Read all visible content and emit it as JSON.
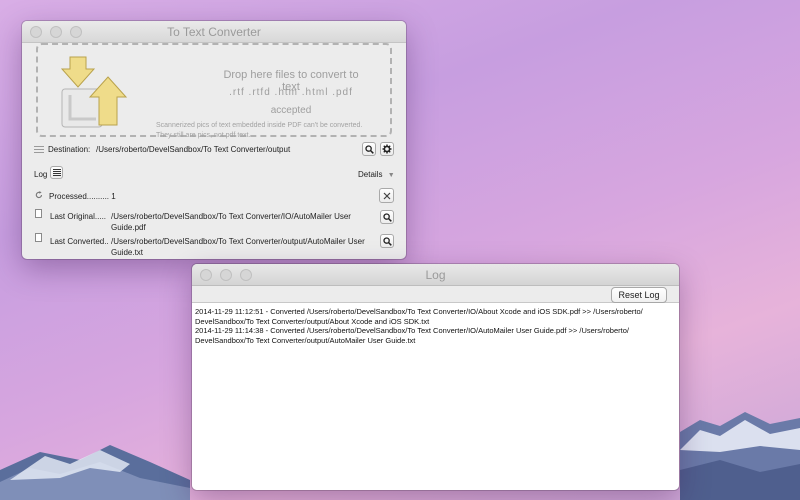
{
  "converter": {
    "title": "To Text Converter",
    "drop": {
      "title": "Drop here files to convert to text",
      "extensions": ".rtf   .rtfd   .htm   .html   .pdf",
      "accepted": "accepted",
      "note_line1": "Scannerized pics of text embedded inside PDF can't be converted.",
      "note_line2": "They still are pics, not pdf text."
    },
    "destination_label": "Destination:",
    "destination_path": "/Users/roberto/DevelSandbox/To Text Converter/output",
    "log_label": "Log",
    "details_label": "Details",
    "processed_label": "Processed.......... 1",
    "last_original_label": "Last Original.....",
    "last_original_path": "/Users/roberto/DevelSandbox/To Text Converter/IO/AutoMailer User Guide.pdf",
    "last_converted_label": "Last Converted..",
    "last_converted_path": "/Users/roberto/DevelSandbox/To Text Converter/output/AutoMailer User Guide.txt"
  },
  "log": {
    "title": "Log",
    "reset_button": "Reset Log",
    "entries": [
      "2014-11-29 11:12:51 - Converted /Users/roberto/DevelSandbox/To Text Converter/IO/About Xcode and iOS SDK.pdf  >>  /Users/roberto/",
      "DevelSandbox/To Text Converter/output/About Xcode and iOS SDK.txt",
      "2014-11-29 11:14:38 - Converted /Users/roberto/DevelSandbox/To Text Converter/IO/AutoMailer User Guide.pdf  >>  /Users/roberto/",
      "DevelSandbox/To Text Converter/output/AutoMailer User Guide.txt"
    ]
  },
  "icons": {
    "search": "magnifier-icon",
    "settings": "gear-icon",
    "close": "x-icon",
    "list": "list-icon",
    "refresh": "refresh-icon",
    "document": "document-icon",
    "drop": "drop-arrows-icon"
  }
}
